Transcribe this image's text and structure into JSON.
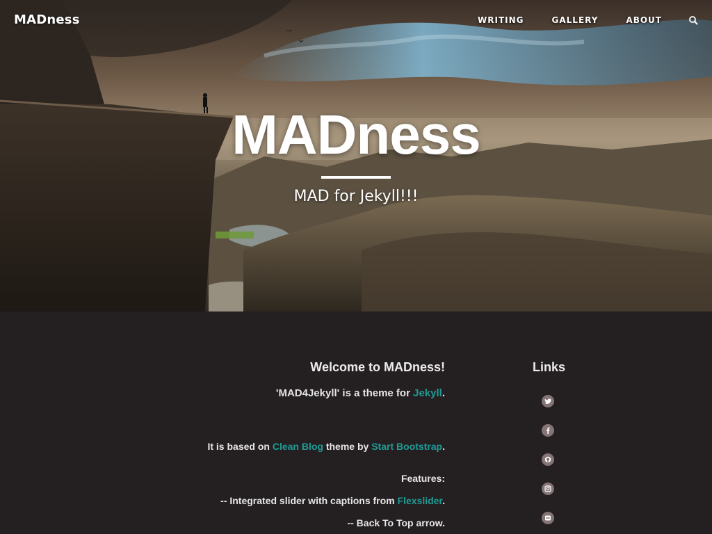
{
  "nav": {
    "brand": "MADness",
    "items": [
      {
        "label": "WRITING"
      },
      {
        "label": "GALLERY"
      },
      {
        "label": "ABOUT"
      }
    ],
    "search_icon": "search-icon"
  },
  "hero": {
    "title": "MADness",
    "subtitle": "MAD for Jekyll!!!"
  },
  "main": {
    "heading": "Welcome to MADness!",
    "lead": {
      "prefix": "'MAD4Jekyll' is a theme for ",
      "link": "Jekyll",
      "suffix": "."
    },
    "based_on": {
      "prefix": "It is based on ",
      "link1": "Clean Blog",
      "middle": " theme by ",
      "link2": "Start Bootstrap",
      "suffix": "."
    },
    "features_label": "Features:",
    "feature_slider": {
      "prefix": "-- Integrated slider with captions from ",
      "link": "Flexslider",
      "suffix": "."
    },
    "feature_top": "-- Back To Top arrow."
  },
  "links": {
    "heading": "Links",
    "items": [
      {
        "icon": "twitter-icon"
      },
      {
        "icon": "facebook-icon"
      },
      {
        "icon": "github-icon"
      },
      {
        "icon": "instagram-icon"
      },
      {
        "icon": "flickr-icon"
      }
    ]
  },
  "colors": {
    "accent": "#1f9c96",
    "content_bg": "#241f21",
    "social_bg": "#847476"
  }
}
